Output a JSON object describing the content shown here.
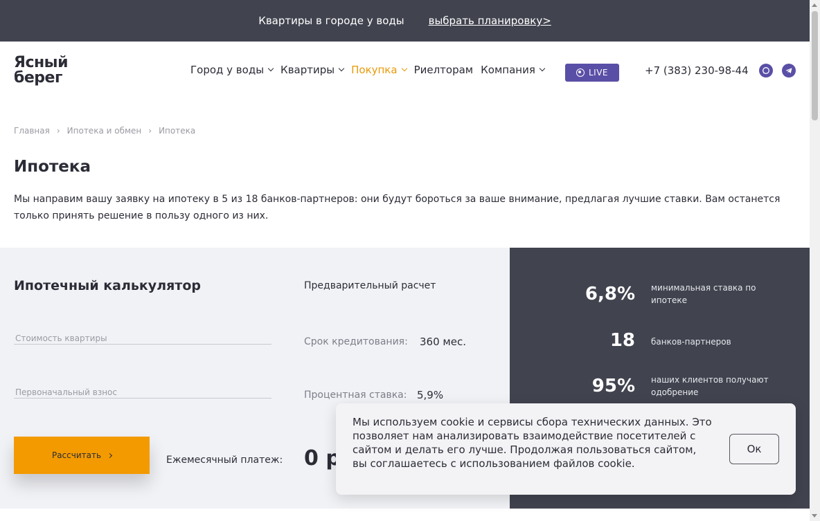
{
  "promo": {
    "text": "Квартиры в городе у воды",
    "link": "выбрать планировку>"
  },
  "logo": {
    "line1": "Ясный",
    "line2": "берег"
  },
  "nav": [
    {
      "label": "Город у воды",
      "dropdown": true,
      "active": false
    },
    {
      "label": "Квартиры",
      "dropdown": true,
      "active": false
    },
    {
      "label": "Покупка",
      "dropdown": true,
      "active": true
    },
    {
      "label": "Риелторам",
      "dropdown": false,
      "active": false
    },
    {
      "label": "Компания",
      "dropdown": true,
      "active": false
    }
  ],
  "live": {
    "label": "LIVE"
  },
  "phone": "+7 (383) 230-98-44",
  "icons": {
    "whatsapp": "whatsapp-icon",
    "telegram": "telegram-icon"
  },
  "breadcrumb": [
    "Главная",
    "Ипотека и обмен",
    "Ипотека"
  ],
  "page": {
    "title": "Ипотека",
    "intro": "Мы направим вашу заявку на ипотеку в 5 из 18 банков-партнеров: они будут бороться за ваше внимание, предлагая лучшие ставки. Вам останется только принять решение в пользу одного из них."
  },
  "calculator": {
    "title": "Ипотечный калькулятор",
    "price_placeholder": "Стоимость квартиры",
    "price_value": "",
    "down_payment_placeholder": "Первоначальный взнос",
    "down_payment_value": "",
    "submit_label": "Рассчитать",
    "pre_title": "Предварительный расчет",
    "term_label": "Срок кредитования:",
    "term_value": "360 мес.",
    "rate_label": "Процентная ставка:",
    "rate_value": "5,9%",
    "monthly_label": "Ежемесячный платеж:",
    "monthly_value": "0 р"
  },
  "stats": [
    {
      "value": "6,8%",
      "text": "минимальная ставка по ипотеке"
    },
    {
      "value": "18",
      "text": "банков-партнеров"
    },
    {
      "value": "95%",
      "text": "наших клиентов получают одобрение"
    }
  ],
  "cookie": {
    "text": "Мы используем cookie и сервисы сбора технических данных. Это позволяет нам анализировать взаимодействие посетителей с сайтом и делать его лучше. Продолжая пользоваться сайтом, вы соглашаетесь с использованием файлов cookie.",
    "ok_label": "Ок"
  },
  "colors": {
    "dark": "#41434f",
    "accent": "#f39a00",
    "violet": "#5a4fa6",
    "active_nav": "#e8990a"
  }
}
